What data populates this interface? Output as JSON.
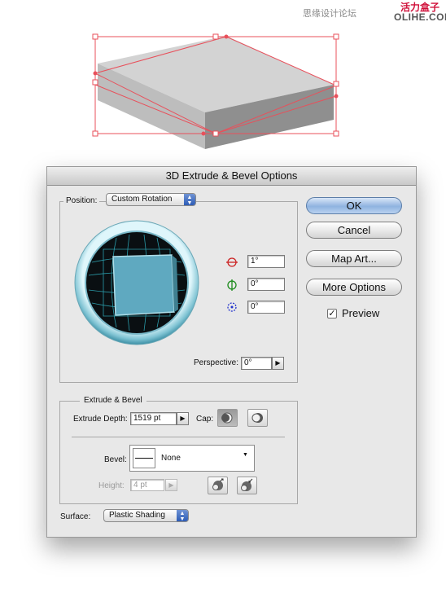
{
  "watermark": {
    "left": "思缘设计论坛",
    "brand_top": "活力盒子",
    "brand_bottom": "OLIHE.COM"
  },
  "dialog": {
    "title": "3D Extrude & Bevel Options",
    "position": {
      "label": "Position:",
      "value": "Custom Rotation",
      "x_rotation": "1°",
      "y_rotation": "0°",
      "z_rotation": "0°",
      "perspective_label": "Perspective:",
      "perspective_value": "0°"
    },
    "extrude_bevel": {
      "group_label": "Extrude & Bevel",
      "depth_label": "Extrude Depth:",
      "depth_value": "1519 pt",
      "cap_label": "Cap:",
      "bevel_label": "Bevel:",
      "bevel_value": "None",
      "height_label": "Height:",
      "height_value": "4 pt"
    },
    "surface": {
      "label": "Surface:",
      "value": "Plastic Shading"
    },
    "buttons": {
      "ok": "OK",
      "cancel": "Cancel",
      "map_art": "Map Art...",
      "more_options": "More Options"
    },
    "preview": {
      "label": "Preview",
      "checked": true
    }
  },
  "icons": {
    "x_axis": "rotate-x-icon",
    "y_axis": "rotate-y-icon",
    "z_axis": "rotate-z-icon",
    "cap_on": "cap-on-icon",
    "cap_off": "cap-off-icon",
    "bevel_out": "bevel-extent-out-icon",
    "bevel_in": "bevel-extent-in-icon"
  },
  "colors": {
    "selection": "#e8505b",
    "x_axis": "#cc2222",
    "y_axis": "#1a8a1a",
    "z_axis": "#2233cc",
    "track_cube": "#5fa9c0"
  }
}
